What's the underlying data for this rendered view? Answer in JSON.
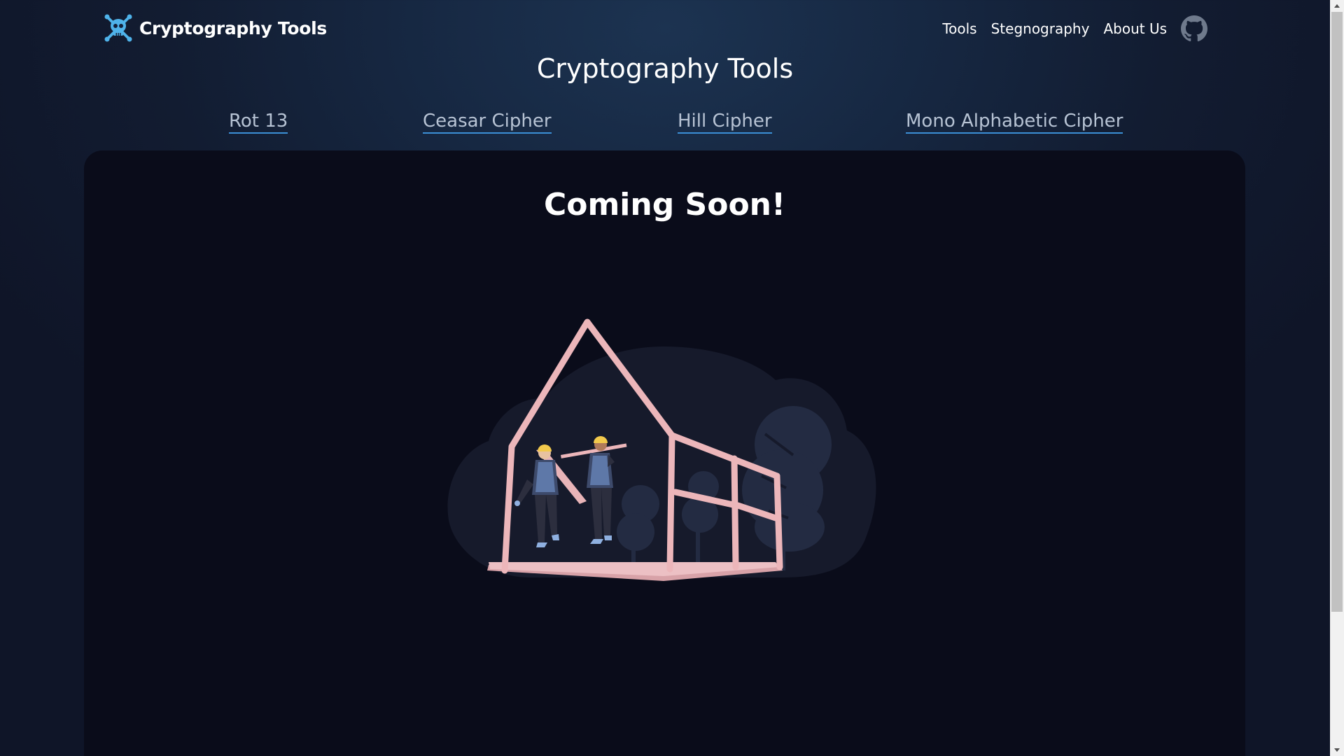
{
  "navbar": {
    "brand": "Cryptography Tools",
    "links": [
      "Tools",
      "Stegnography",
      "About Us"
    ],
    "brand_icon": "skull-crossbones-icon",
    "github_icon": "github-icon"
  },
  "header": {
    "title": "Cryptography Tools"
  },
  "tabs": [
    "Rot 13",
    "Ceasar Cipher",
    "Hill Cipher",
    "Mono Alphabetic Cipher"
  ],
  "main": {
    "heading": "Coming Soon!",
    "illustration": "under-construction-illustration"
  },
  "colors": {
    "background": "#13203a",
    "card": "#0a0c1a",
    "accent": "#3b8fd6",
    "brand_icon": "#4fb3ea",
    "frame": "#e8b4b8"
  }
}
